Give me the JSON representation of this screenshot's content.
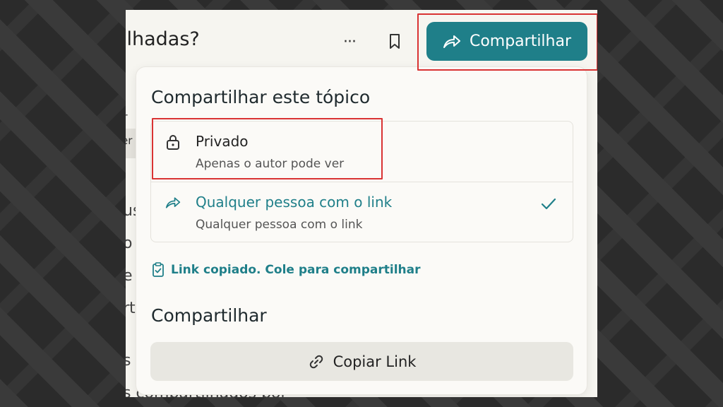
{
  "header": {
    "title": "ilhadas?",
    "more_label": "···",
    "share_label": "Compartilhar"
  },
  "background_text": {
    "line1": "r",
    "tag": "er",
    "l2": "us",
    "l3": "o",
    "l4": "e",
    "l5": "rt",
    "l6": "s",
    "bottom": "s compartilhados por"
  },
  "share_panel": {
    "title": "Compartilhar este tópico",
    "options": [
      {
        "label": "Privado",
        "description": "Apenas o autor pode ver",
        "icon": "lock-icon",
        "selected": false
      },
      {
        "label": "Qualquer pessoa com o link",
        "description": "Qualquer pessoa com o link",
        "icon": "share-arrow-icon",
        "selected": true
      }
    ],
    "copied_message": "Link copiado. Cole para compartilhar",
    "share_section_title": "Compartilhar",
    "copy_link_label": "Copiar Link"
  },
  "colors": {
    "accent": "#1f7f89",
    "highlight": "#d93333"
  }
}
